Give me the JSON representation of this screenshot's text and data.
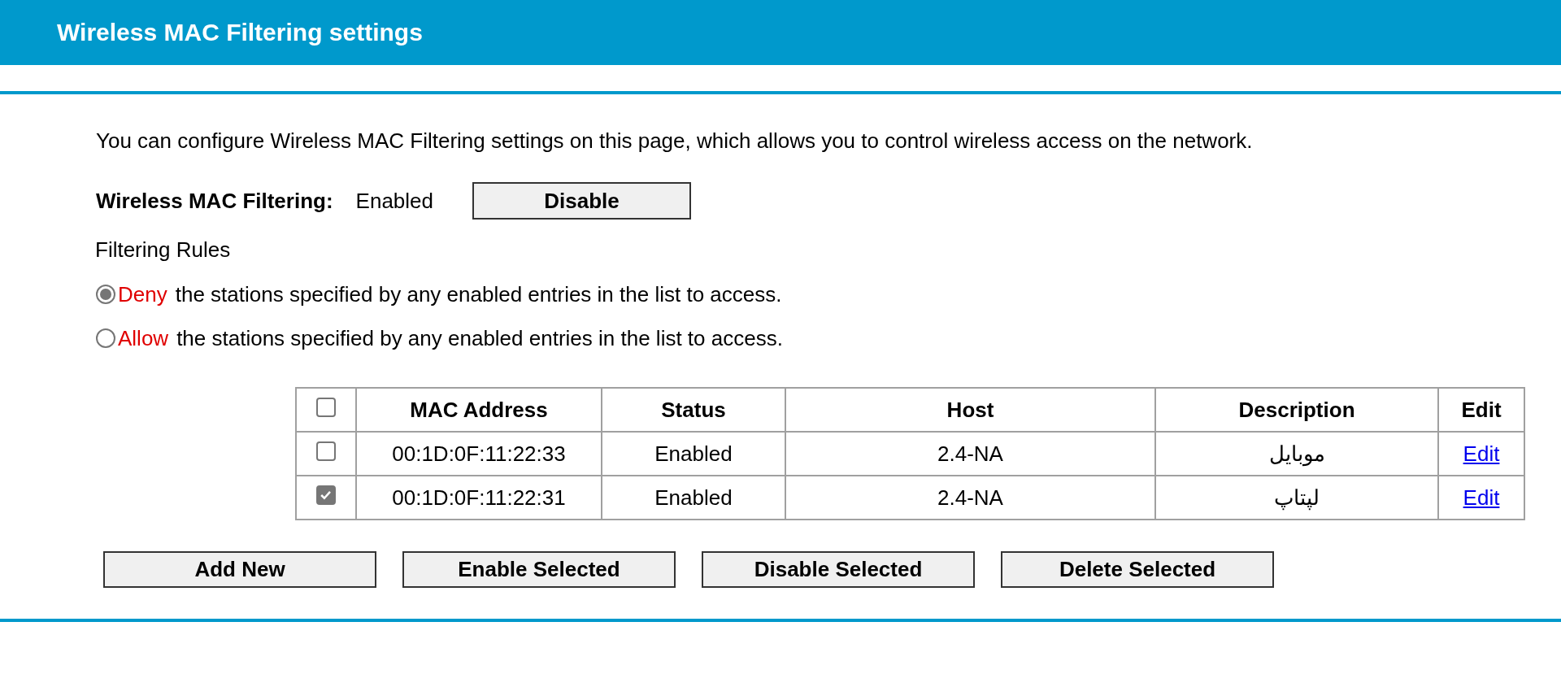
{
  "header": {
    "title": "Wireless MAC Filtering settings"
  },
  "intro": "You can configure Wireless MAC Filtering settings on this page, which allows you to control wireless access on the network.",
  "filtering": {
    "label": "Wireless MAC Filtering:",
    "value": "Enabled",
    "button": "Disable"
  },
  "rules": {
    "title": "Filtering Rules",
    "options": [
      {
        "keyword": "Deny",
        "text": "the stations specified by any enabled entries in the list to access.",
        "selected": true
      },
      {
        "keyword": "Allow",
        "text": "the stations specified by any enabled entries in the list to access.",
        "selected": false
      }
    ]
  },
  "table": {
    "select_all": {
      "checked": false
    },
    "columns": [
      "MAC Address",
      "Status",
      "Host",
      "Description",
      "Edit"
    ],
    "rows": [
      {
        "checked": false,
        "mac": "00:1D:0F:11:22:33",
        "status": "Enabled",
        "host": "2.4-NA",
        "description": "موبایل",
        "edit": "Edit"
      },
      {
        "checked": true,
        "mac": "00:1D:0F:11:22:31",
        "status": "Enabled",
        "host": "2.4-NA",
        "description": "لپتاپ",
        "edit": "Edit"
      }
    ]
  },
  "buttons": [
    "Add New",
    "Enable Selected",
    "Disable Selected",
    "Delete Selected"
  ]
}
